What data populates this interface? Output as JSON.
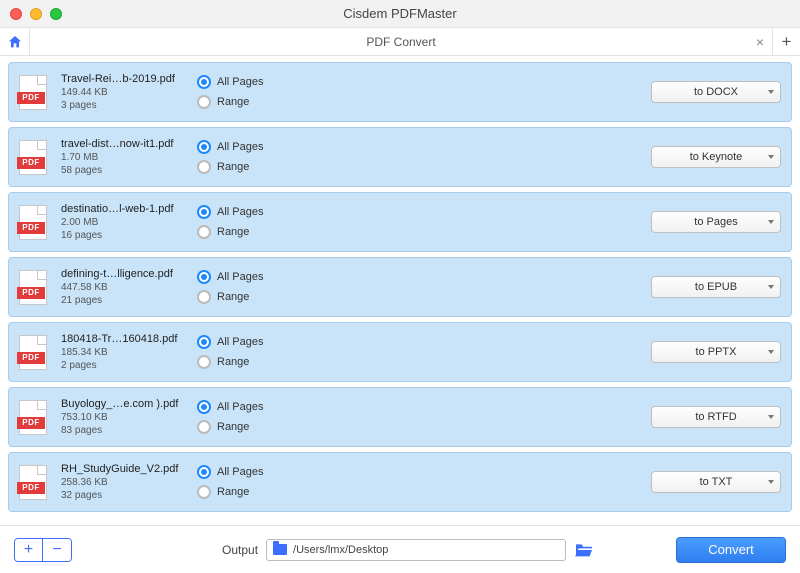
{
  "window": {
    "title": "Cisdem PDFMaster"
  },
  "tab": {
    "label": "PDF Convert"
  },
  "labels": {
    "all_pages": "All Pages",
    "range": "Range",
    "pdf_badge": "PDF",
    "output": "Output",
    "convert": "Convert"
  },
  "output_path": "/Users/lmx/Desktop",
  "files": [
    {
      "name": "Travel-Rei…b-2019.pdf",
      "size": "149.44 KB",
      "pages": "3 pages",
      "format": "to DOCX"
    },
    {
      "name": "travel-dist…now-it1.pdf",
      "size": "1.70 MB",
      "pages": "58 pages",
      "format": "to Keynote"
    },
    {
      "name": "destinatio…l-web-1.pdf",
      "size": "2.00 MB",
      "pages": "16 pages",
      "format": "to Pages"
    },
    {
      "name": "defining-t…lligence.pdf",
      "size": "447.58 KB",
      "pages": "21 pages",
      "format": "to EPUB"
    },
    {
      "name": "180418-Tr…160418.pdf",
      "size": "185.34 KB",
      "pages": "2 pages",
      "format": "to PPTX"
    },
    {
      "name": "Buyology_…e.com ).pdf",
      "size": "753.10 KB",
      "pages": "83 pages",
      "format": "to RTFD"
    },
    {
      "name": "RH_StudyGuide_V2.pdf",
      "size": "258.36 KB",
      "pages": "32 pages",
      "format": "to TXT"
    }
  ]
}
